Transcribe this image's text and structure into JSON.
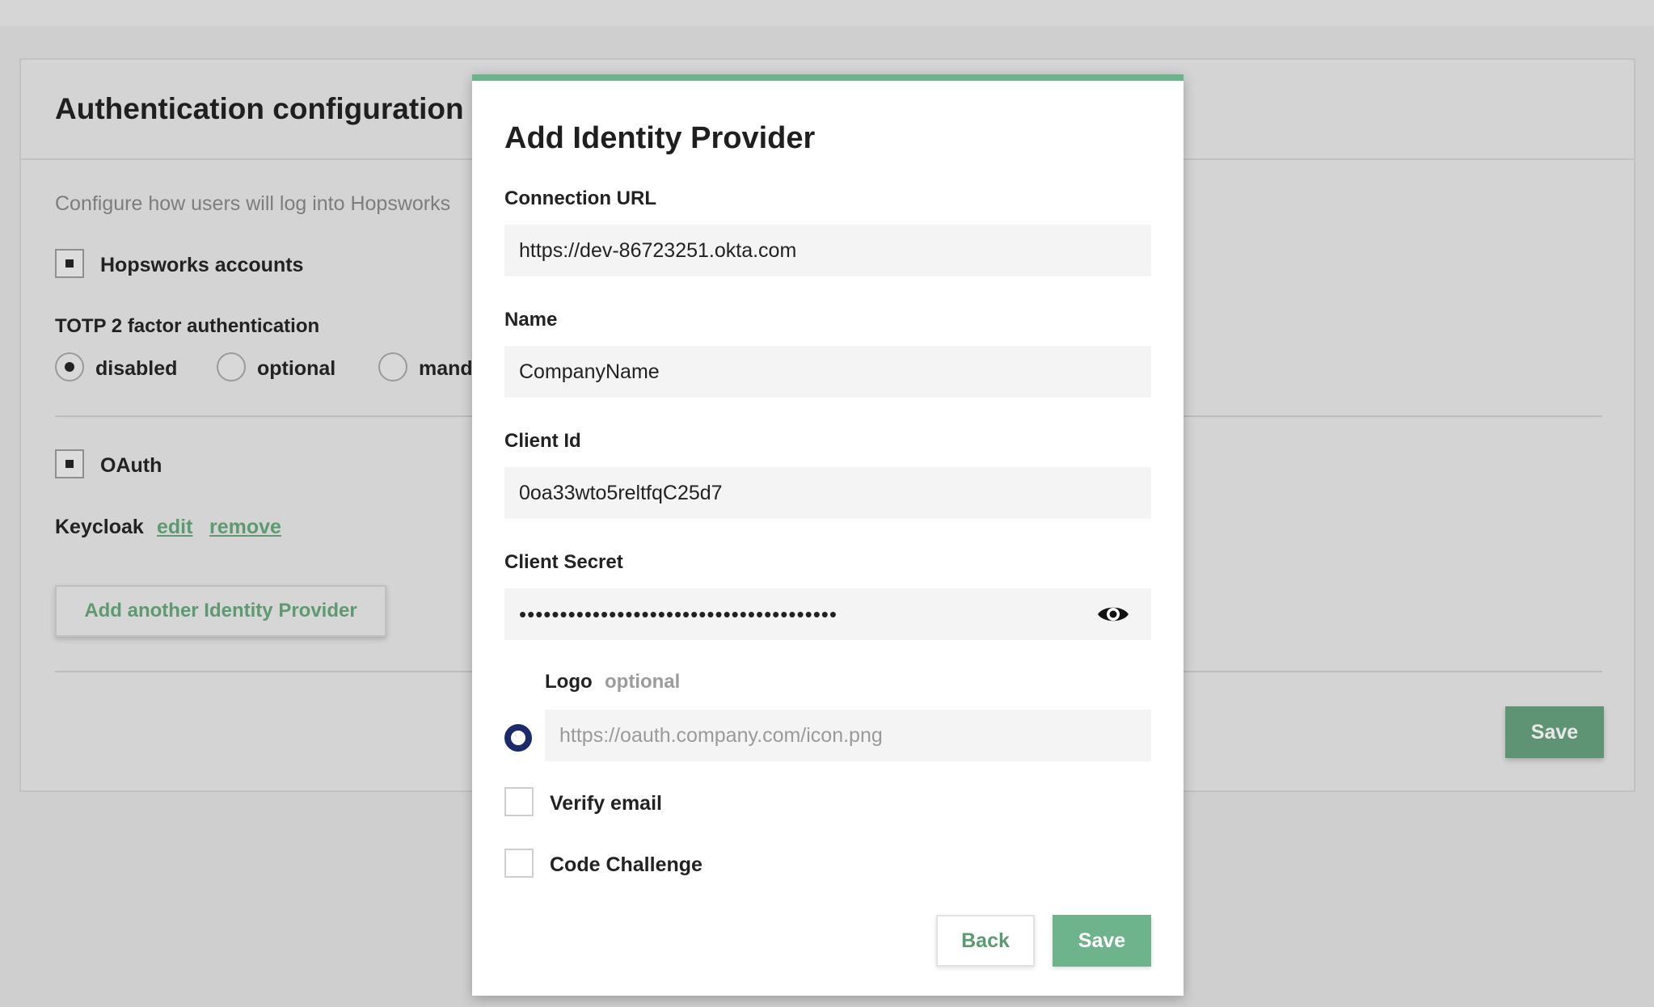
{
  "background": {
    "title": "Authentication configuration",
    "description": "Configure how users will log into Hopsworks",
    "hopsworks_accounts_label": "Hopsworks accounts",
    "totp_label": "TOTP 2 factor authentication",
    "totp_options": [
      "disabled",
      "optional",
      "mand"
    ],
    "totp_selected": "disabled",
    "oauth_label": "OAuth",
    "provider_name": "Keycloak",
    "edit_link": "edit",
    "remove_link": "remove",
    "add_provider_button": "Add another Identity Provider",
    "save_button": "Save"
  },
  "modal": {
    "title": "Add Identity Provider",
    "connection_url": {
      "label": "Connection URL",
      "value": "https://dev-86723251.okta.com"
    },
    "name": {
      "label": "Name",
      "value": "CompanyName"
    },
    "client_id": {
      "label": "Client Id",
      "value": "0oa33wto5reltfqC25d7"
    },
    "client_secret": {
      "label": "Client Secret",
      "value": "•••••••••••••••••••••••••••••••••••••••"
    },
    "logo": {
      "label": "Logo",
      "optional": "optional",
      "placeholder": "https://oauth.company.com/icon.png"
    },
    "verify_email_label": "Verify email",
    "code_challenge_label": "Code Challenge",
    "back_button": "Back",
    "save_button": "Save"
  },
  "colors": {
    "accent": "#6db38b",
    "radio_selected": "#1b2a6b"
  }
}
